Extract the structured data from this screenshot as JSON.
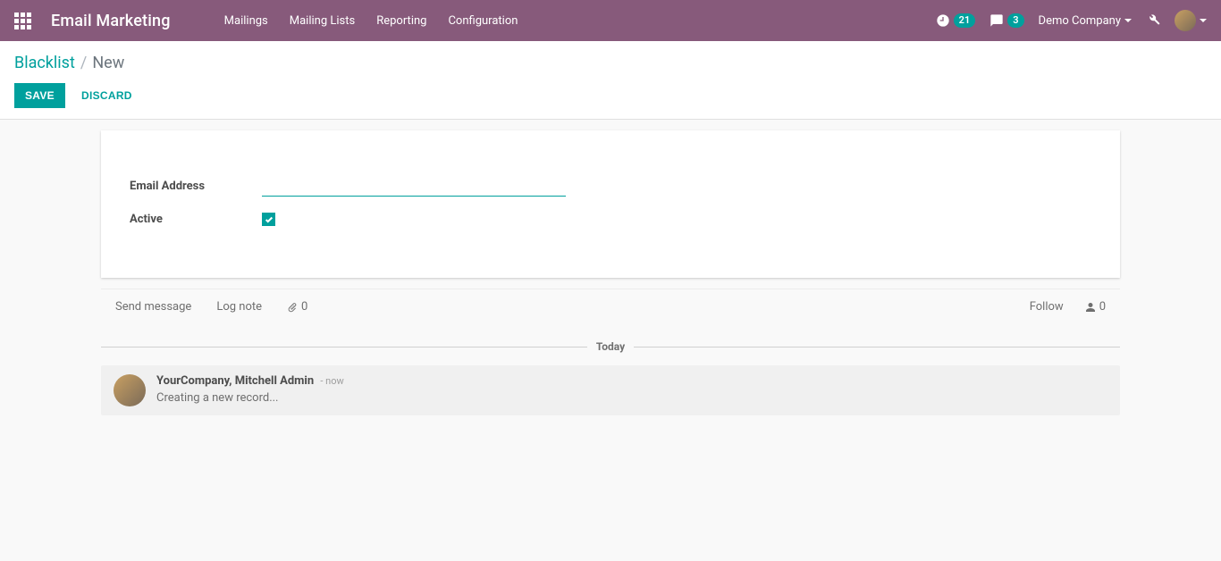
{
  "navbar": {
    "app_title": "Email Marketing",
    "menu": [
      "Mailings",
      "Mailing Lists",
      "Reporting",
      "Configuration"
    ],
    "activities_count": "21",
    "messages_count": "3",
    "company": "Demo Company"
  },
  "breadcrumb": {
    "root": "Blacklist",
    "current": "New"
  },
  "actions": {
    "save": "SAVE",
    "discard": "DISCARD"
  },
  "form": {
    "email_label": "Email Address",
    "email_value": "",
    "active_label": "Active",
    "active_checked": true
  },
  "chatter": {
    "send_message": "Send message",
    "log_note": "Log note",
    "attachments_count": "0",
    "follow": "Follow",
    "followers_count": "0",
    "today_label": "Today",
    "message": {
      "author": "YourCompany, Mitchell Admin",
      "time": "- now",
      "text": "Creating a new record..."
    }
  }
}
